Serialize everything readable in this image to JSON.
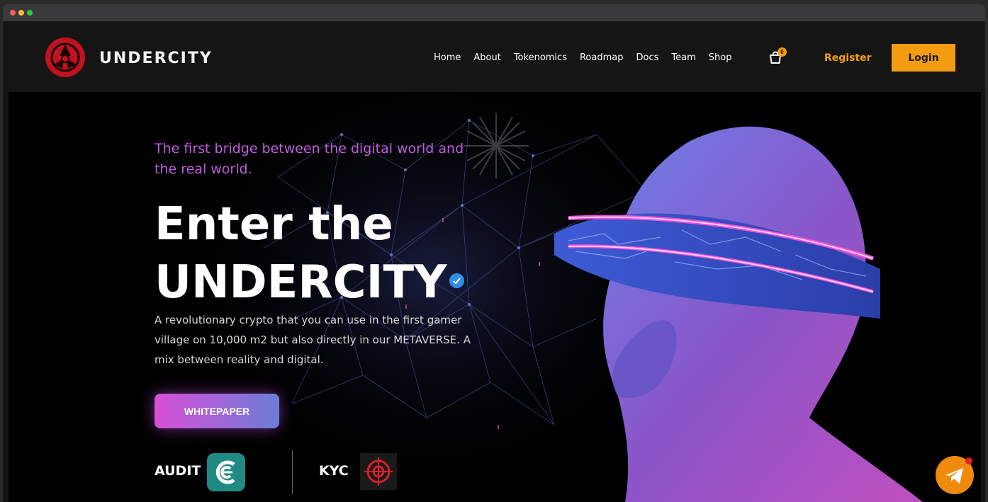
{
  "brand": {
    "name": "UNDERCITY"
  },
  "nav": {
    "links": [
      "Home",
      "About",
      "Tokenomics",
      "Roadmap",
      "Docs",
      "Team",
      "Shop"
    ],
    "cart_count": "0",
    "register_label": "Register",
    "login_label": "Login"
  },
  "hero": {
    "tagline": "The first bridge between the digital world and the real world.",
    "headline_line1": "Enter the",
    "headline_line2": "UNDERCITY",
    "description": "A revolutionary crypto that you can use in the first gamer village  on 10,000 m2 but also directly in our METAVERSE. A mix between reality and digital.",
    "whitepaper_label": "WHITEPAPER",
    "audit_label": "AUDIT",
    "kyc_label": "KYC"
  },
  "colors": {
    "accent": "#f39c12",
    "tagline": "#c05ee0",
    "background": "#000000",
    "verified": "#2f8fe6"
  },
  "icons": [
    "cart-icon",
    "verified-icon",
    "telegram-icon",
    "audit-logo-icon",
    "kyc-target-icon"
  ]
}
